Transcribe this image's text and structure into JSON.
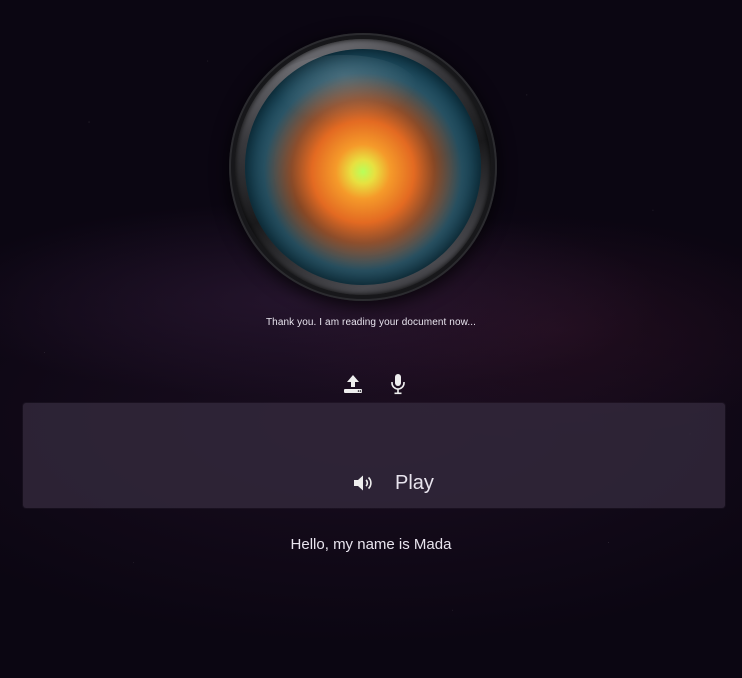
{
  "assistant": {
    "status_text": "Thank you. I am reading your document now...",
    "greeting": "Hello, my name is Mada"
  },
  "controls": {
    "upload_icon": "upload-icon",
    "mic_icon": "microphone-icon"
  },
  "player": {
    "play_label": "Play",
    "speaker_icon": "speaker-icon"
  },
  "colors": {
    "background": "#0b0612",
    "panel": "#342a3e",
    "text": "#e8e4ee",
    "orb_center": "#b8ff5a",
    "orb_mid": "#e36a22",
    "orb_outer": "#0f4a63"
  }
}
